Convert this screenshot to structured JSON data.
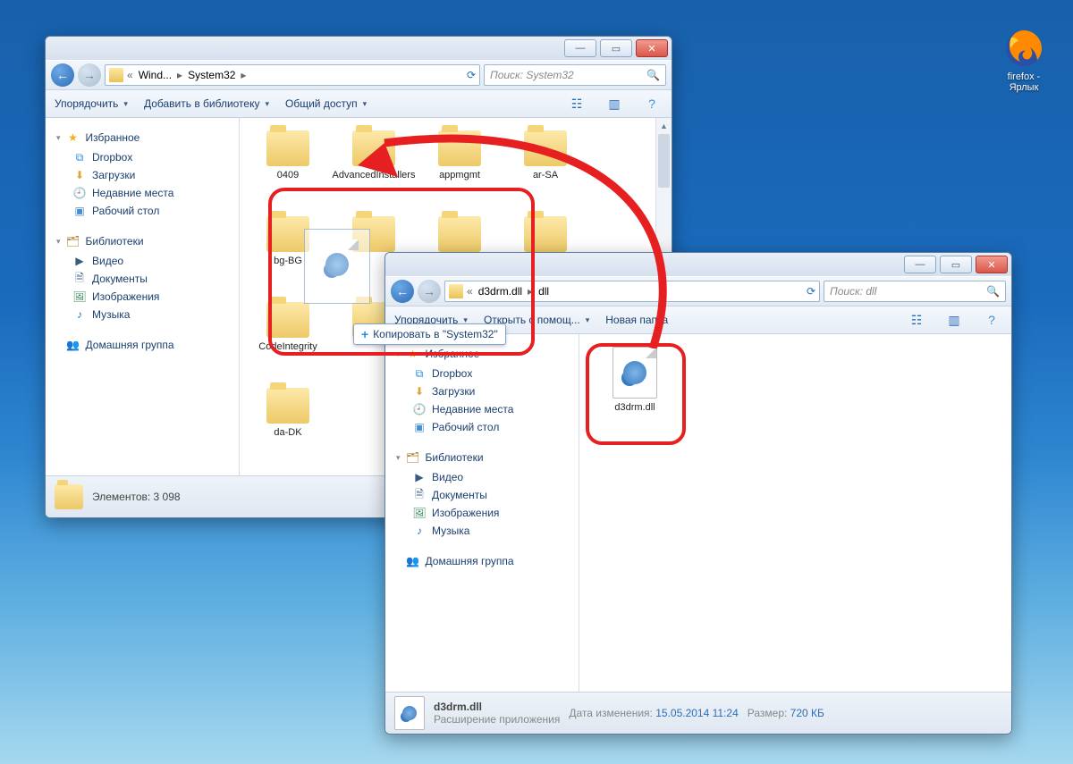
{
  "desktop": {
    "icon_label": "firefox - Ярлык"
  },
  "window1": {
    "breadcrumb": {
      "p1": "Wind...",
      "p2": "System32"
    },
    "search_placeholder": "Поиск: System32",
    "toolbar": {
      "organize": "Упорядочить",
      "addlib": "Добавить в библиотеку",
      "share": "Общий доступ"
    },
    "sidebar": {
      "fav": "Избранное",
      "dropbox": "Dropbox",
      "downloads": "Загрузки",
      "recent": "Недавние места",
      "desktop": "Рабочий стол",
      "lib": "Библиотеки",
      "video": "Видео",
      "docs": "Документы",
      "images": "Изображения",
      "music": "Музыка",
      "homegroup": "Домашняя группа"
    },
    "folders": [
      "0409",
      "AdvancedInstallers",
      "appmgmt",
      "ar-SA",
      "bg-BG",
      "",
      "",
      "",
      "CodeIntegrity",
      "",
      "",
      "",
      "da-DK"
    ],
    "status": "Элементов: 3 098",
    "copy_tip": "Копировать в \"System32\""
  },
  "window2": {
    "breadcrumb": {
      "pre": "«",
      "p1": "d3drm.dll",
      "p2": "dll"
    },
    "search_placeholder": "Поиск: dll",
    "toolbar": {
      "organize": "Упорядочить",
      "openwith": "Открыть с помощ...",
      "newfolder": "Новая папка"
    },
    "sidebar": {
      "fav": "Избранное",
      "dropbox": "Dropbox",
      "downloads": "Загрузки",
      "recent": "Недавние места",
      "desktop": "Рабочий стол",
      "lib": "Библиотеки",
      "video": "Видео",
      "docs": "Документы",
      "images": "Изображения",
      "music": "Музыка",
      "homegroup": "Домашняя группа"
    },
    "file": {
      "name": "d3drm.dll"
    },
    "status": {
      "name": "d3drm.dll",
      "type": "Расширение приложения",
      "date_k": "Дата изменения:",
      "date_v": "15.05.2014 11:24",
      "size_k": "Размер:",
      "size_v": "720 КБ"
    }
  }
}
